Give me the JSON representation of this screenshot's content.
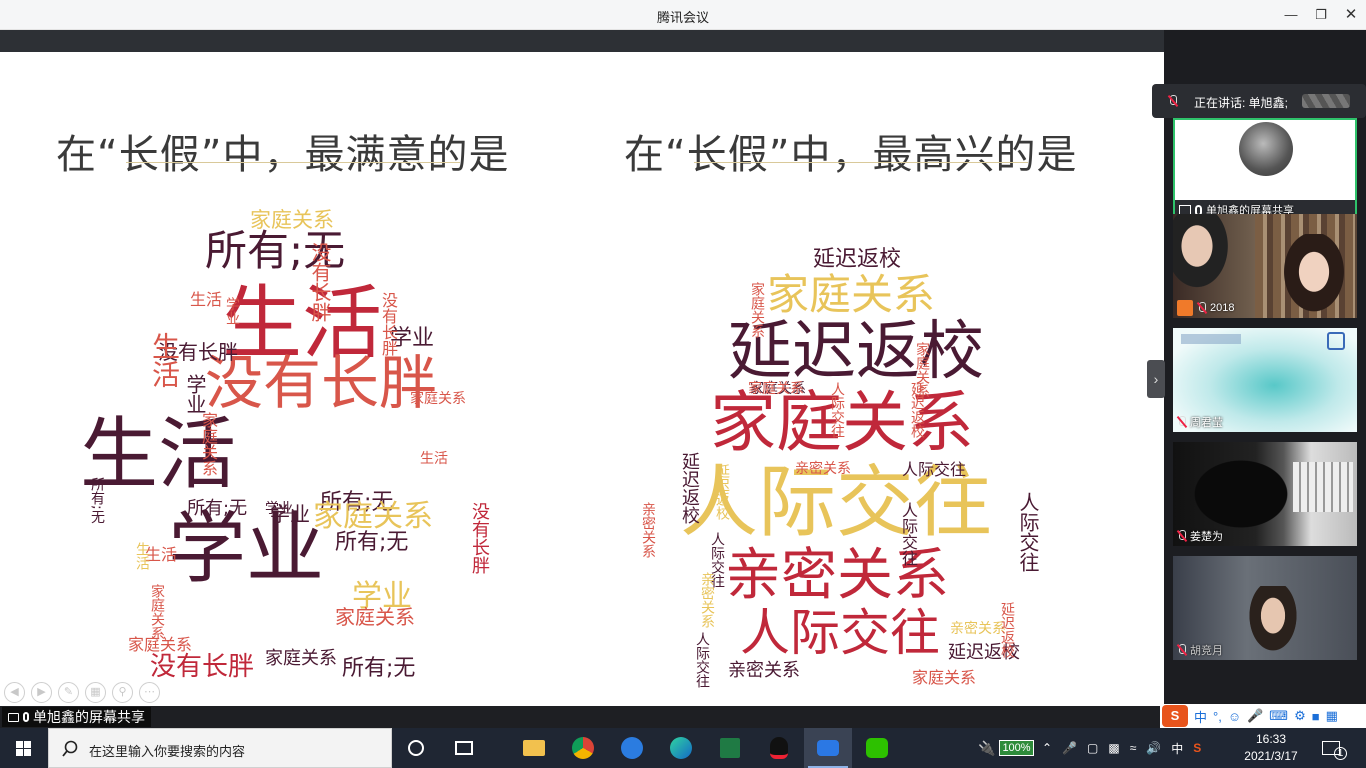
{
  "window": {
    "title": "腾讯会议"
  },
  "slide": {
    "left_heading": "在“长假”中，最满意的是",
    "right_heading": "在“长假”中，最高兴的是",
    "left_cloud": [
      {
        "t": "家庭关系"
      },
      {
        "t": "所有;无"
      },
      {
        "t": "学业"
      },
      {
        "t": "生活"
      },
      {
        "t": "没有长胖"
      },
      {
        "t": "生活"
      },
      {
        "t": "没有长胖"
      },
      {
        "t": "学业"
      },
      {
        "t": "生活"
      },
      {
        "t": "所有;无"
      },
      {
        "t": "学业"
      },
      {
        "t": "生活"
      },
      {
        "t": "学业"
      },
      {
        "t": "所有;无"
      },
      {
        "t": "学业"
      },
      {
        "t": "家庭关系"
      },
      {
        "t": "家庭关系"
      },
      {
        "t": "生活"
      },
      {
        "t": "家庭关系"
      },
      {
        "t": "所有;无"
      },
      {
        "t": "没有长胖"
      },
      {
        "t": "所有;无"
      },
      {
        "t": "家庭关系"
      },
      {
        "t": "生活"
      },
      {
        "t": "家庭关系"
      },
      {
        "t": "学业"
      },
      {
        "t": "没有长胖"
      },
      {
        "t": "家庭关系"
      },
      {
        "t": "没有长胖"
      },
      {
        "t": "生活"
      },
      {
        "t": "学业"
      },
      {
        "t": "家庭关系"
      },
      {
        "t": "所有;无"
      },
      {
        "t": "没有长胖"
      }
    ],
    "right_cloud": [
      {
        "t": "延迟返校"
      },
      {
        "t": "家庭关系"
      },
      {
        "t": "延迟返校"
      },
      {
        "t": "家庭关系"
      },
      {
        "t": "人际交往"
      },
      {
        "t": "亲密关系"
      },
      {
        "t": "人际交往"
      },
      {
        "t": "家庭关系"
      },
      {
        "t": "人际交往"
      },
      {
        "t": "延迟返校"
      },
      {
        "t": "人际交往"
      },
      {
        "t": "亲密关系"
      },
      {
        "t": "人际交往"
      },
      {
        "t": "延迟返校"
      },
      {
        "t": "家庭关系"
      },
      {
        "t": "亲密关系"
      },
      {
        "t": "延迟返校"
      },
      {
        "t": "人际交往"
      },
      {
        "t": "家庭关系"
      },
      {
        "t": "延迟返校"
      },
      {
        "t": "人际交往"
      },
      {
        "t": "亲密关系"
      },
      {
        "t": "延迟返校"
      },
      {
        "t": "亲密关系"
      },
      {
        "t": "家庭关系"
      },
      {
        "t": "人际交往"
      },
      {
        "t": "亲密关系"
      },
      {
        "t": "家庭关系"
      }
    ]
  },
  "share_label": "单旭鑫的屏幕共享",
  "panel": {
    "speaking": "正在讲话: 单旭鑫;",
    "participants": [
      {
        "name": "单旭鑫的屏幕共享"
      },
      {
        "name": "2018"
      },
      {
        "name": "周君莹"
      },
      {
        "name": "姜楚为"
      },
      {
        "name": "胡竞月"
      }
    ]
  },
  "taskbar": {
    "search_placeholder": "在这里输入你要搜索的内容",
    "battery": "100%",
    "ime_lang": "中",
    "time": "16:33",
    "date": "2021/3/17",
    "notifications": "1"
  },
  "colors": {
    "wine": "#4a1a33",
    "red": "#c0283a",
    "gold": "#e8c45a",
    "coral": "#d8564a"
  }
}
